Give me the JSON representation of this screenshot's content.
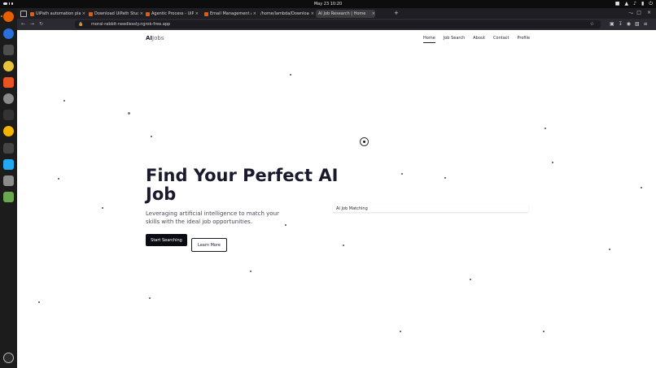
{
  "system": {
    "clock": "May 23  10:20",
    "tray_icons": [
      "shield-icon",
      "network-icon",
      "volume-icon",
      "battery-icon",
      "power-icon"
    ]
  },
  "dock": {
    "apps": [
      {
        "name": "firefox-icon",
        "color": "#e66000"
      },
      {
        "name": "thunderbird-icon",
        "color": "#2a6fdb"
      },
      {
        "name": "files-icon",
        "color": "#4e4e4e"
      },
      {
        "name": "rhythmbox-icon",
        "color": "#e8c23a"
      },
      {
        "name": "software-icon",
        "color": "#e95420"
      },
      {
        "name": "settings-icon",
        "color": "#8a8a8a"
      },
      {
        "name": "terminal-icon",
        "color": "#333333"
      },
      {
        "name": "chrome-icon",
        "color": "#f4b400"
      },
      {
        "name": "terminal-icon-2",
        "color": "#444444"
      },
      {
        "name": "vscode-icon",
        "color": "#23a9f2"
      },
      {
        "name": "text-editor-icon",
        "color": "#8c8c8c"
      },
      {
        "name": "trash-icon",
        "color": "#6aa84f"
      }
    ],
    "show_apps": "ubuntu-icon"
  },
  "browser": {
    "tabs": [
      {
        "title": "UiPath automation platfo",
        "favicon_color": "#e8590c",
        "active": false
      },
      {
        "title": "Download UiPath Studio",
        "favicon_color": "#e8590c",
        "active": false
      },
      {
        "title": "Agentic Process - UiPath",
        "favicon_color": "#e8590c",
        "active": false
      },
      {
        "title": "Email Management Agen",
        "favicon_color": "#e8590c",
        "active": false
      },
      {
        "title": "/home/lambda/Downloads/",
        "favicon_color": "#777777",
        "active": false
      },
      {
        "title": "AI Job Research | Home",
        "favicon_color": "#555555",
        "active": true
      }
    ],
    "new_tab": "+",
    "url": "moral-rabbit-needlessly.ngrok-free.app"
  },
  "site": {
    "logo_ai": "AI",
    "logo_jobs": "Jobs",
    "nav": [
      {
        "label": "Home",
        "active": true
      },
      {
        "label": "Job Search",
        "active": false
      },
      {
        "label": "About",
        "active": false
      },
      {
        "label": "Contact",
        "active": false
      },
      {
        "label": "Profile",
        "active": false
      }
    ],
    "hero": {
      "title": "Find Your Perfect AI Job",
      "subtitle": "Leveraging artificial intelligence to match your skills with the ideal job opportunities.",
      "primary_button": "Start Searching",
      "secondary_button": "Learn More"
    },
    "card_label": "AI Job Matching"
  }
}
